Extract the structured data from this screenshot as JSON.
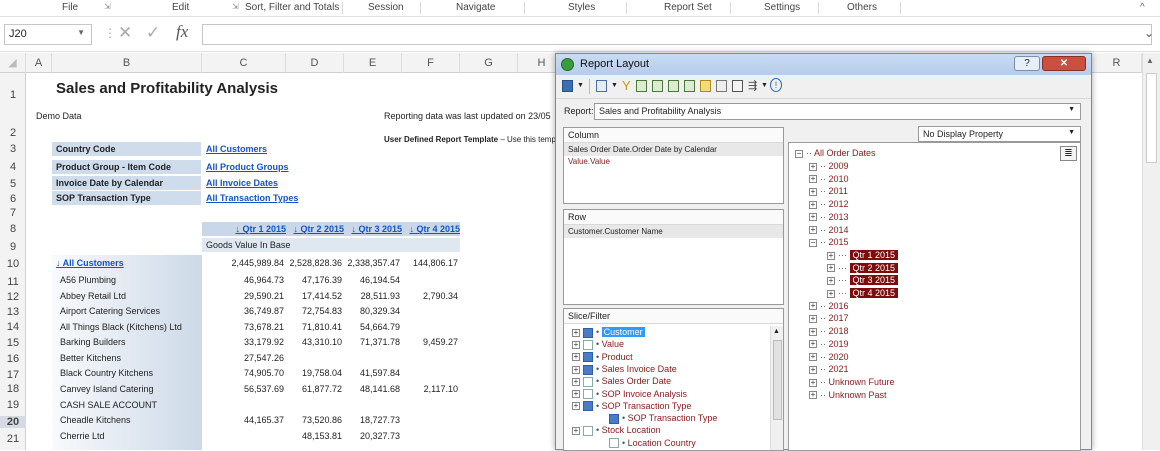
{
  "ribbon": {
    "tabs": [
      "File",
      "Edit",
      "Sort, Filter and Totals",
      "Session",
      "Navigate",
      "Styles",
      "Report Set",
      "Settings",
      "Others"
    ]
  },
  "formula_bar": {
    "name_box": "J20",
    "fx_label": "fx",
    "formula": ""
  },
  "columns": [
    "A",
    "B",
    "C",
    "D",
    "E",
    "F",
    "G",
    "H",
    "R"
  ],
  "rows": [
    "1",
    "2",
    "3",
    "4",
    "5",
    "6",
    "7",
    "8",
    "9",
    "10",
    "11",
    "12",
    "13",
    "14",
    "15",
    "16",
    "17",
    "18",
    "19",
    "20",
    "21"
  ],
  "sheet": {
    "title": "Sales and Profitability Analysis",
    "subtitle": "Demo Data",
    "reporting_note": "Reporting data was last updated on 23/05",
    "template_note_bold": "User Defined Report Template",
    "template_note_rest": " – Use this temp",
    "filters": [
      {
        "label": "Country Code",
        "value": "All Customers"
      },
      {
        "label": "Product Group - Item Code",
        "value": "All Product Groups"
      },
      {
        "label": "Invoice Date by Calendar",
        "value": "All Invoice Dates"
      },
      {
        "label": "SOP Transaction Type",
        "value": "All Transaction Types"
      }
    ],
    "quarter_headers": [
      "↓ Qtr 1 2015",
      "↓ Qtr 2 2015",
      "↓ Qtr 3 2015",
      "↓ Qtr 4 2015"
    ],
    "measure_label": "Goods Value In Base",
    "all_customers": {
      "name": "↓ All Customers",
      "values": [
        "2,445,989.84",
        "2,528,828.36",
        "2,338,357.47",
        "144,806.17"
      ]
    },
    "customers": [
      {
        "name": "A56 Plumbing",
        "values": [
          "46,964.73",
          "47,176.39",
          "46,194.54",
          ""
        ]
      },
      {
        "name": "Abbey Retail Ltd",
        "values": [
          "29,590.21",
          "17,414.52",
          "28,511.93",
          "2,790.34"
        ]
      },
      {
        "name": "Airport Catering Services",
        "values": [
          "36,749.87",
          "72,754.83",
          "80,329.34",
          ""
        ]
      },
      {
        "name": "All Things Black (Kitchens) Ltd",
        "values": [
          "73,678.21",
          "71,810.41",
          "54,664.79",
          ""
        ]
      },
      {
        "name": "Barking Builders",
        "values": [
          "33,179.92",
          "43,310.10",
          "71,371.78",
          "9,459.27"
        ]
      },
      {
        "name": "Better Kitchens",
        "values": [
          "27,547.26",
          "",
          "",
          ""
        ]
      },
      {
        "name": "Black Country Kitchens",
        "values": [
          "74,905.70",
          "19,758.04",
          "41,597.84",
          ""
        ]
      },
      {
        "name": "Canvey Island Catering",
        "values": [
          "56,537.69",
          "61,877.72",
          "48,141.68",
          "2,117.10"
        ]
      },
      {
        "name": "CASH SALE ACCOUNT",
        "values": [
          "",
          "",
          "",
          ""
        ]
      },
      {
        "name": "Cheadle Kitchens",
        "values": [
          "44,165.37",
          "73,520.86",
          "18,727.73",
          ""
        ]
      },
      {
        "name": "Cherrie Ltd",
        "values": [
          "",
          "48,153.81",
          "20,327.73",
          ""
        ]
      }
    ]
  },
  "dialog": {
    "title": "Report Layout",
    "report_label": "Report:",
    "report_value": "Sales and Profitability Analysis",
    "column_header": "Column",
    "column_items": [
      "Sales Order Date.Order Date by Calendar",
      "Value.Value"
    ],
    "row_header": "Row",
    "row_items": [
      "Customer.Customer Name"
    ],
    "slice_header": "Slice/Filter",
    "slice_items": [
      {
        "label": "Customer",
        "checked": true,
        "selected": true
      },
      {
        "label": "Value",
        "checked": false
      },
      {
        "label": "Product",
        "checked": true
      },
      {
        "label": "Sales Invoice Date",
        "checked": true
      },
      {
        "label": "Sales Order Date",
        "checked": false
      },
      {
        "label": "SOP Invoice Analysis",
        "checked": false
      },
      {
        "label": "SOP Transaction Type",
        "checked": true
      },
      {
        "label": "SOP Transaction Type",
        "checked": true,
        "child": true
      },
      {
        "label": "Stock Location",
        "checked": false
      },
      {
        "label": "Location Country",
        "checked": false,
        "child": true
      }
    ],
    "display_property": "No Display Property",
    "tree_root": "All Order Dates",
    "years_before": [
      "2009",
      "2010",
      "2011",
      "2012",
      "2013",
      "2014",
      "2015"
    ],
    "quarters": [
      "Qtr 1 2015",
      "Qtr 2 2015",
      "Qtr 3 2015",
      "Qtr 4 2015"
    ],
    "years_after": [
      "2016",
      "2017",
      "2018",
      "2019",
      "2020",
      "2021",
      "Unknown Future",
      "Unknown Past"
    ]
  },
  "colors": {
    "accent": "#1155cc",
    "tree_text": "#8b1a1a",
    "quarter_fill": "#7d0c0c",
    "filter_label_fill": "#cfdceb"
  }
}
